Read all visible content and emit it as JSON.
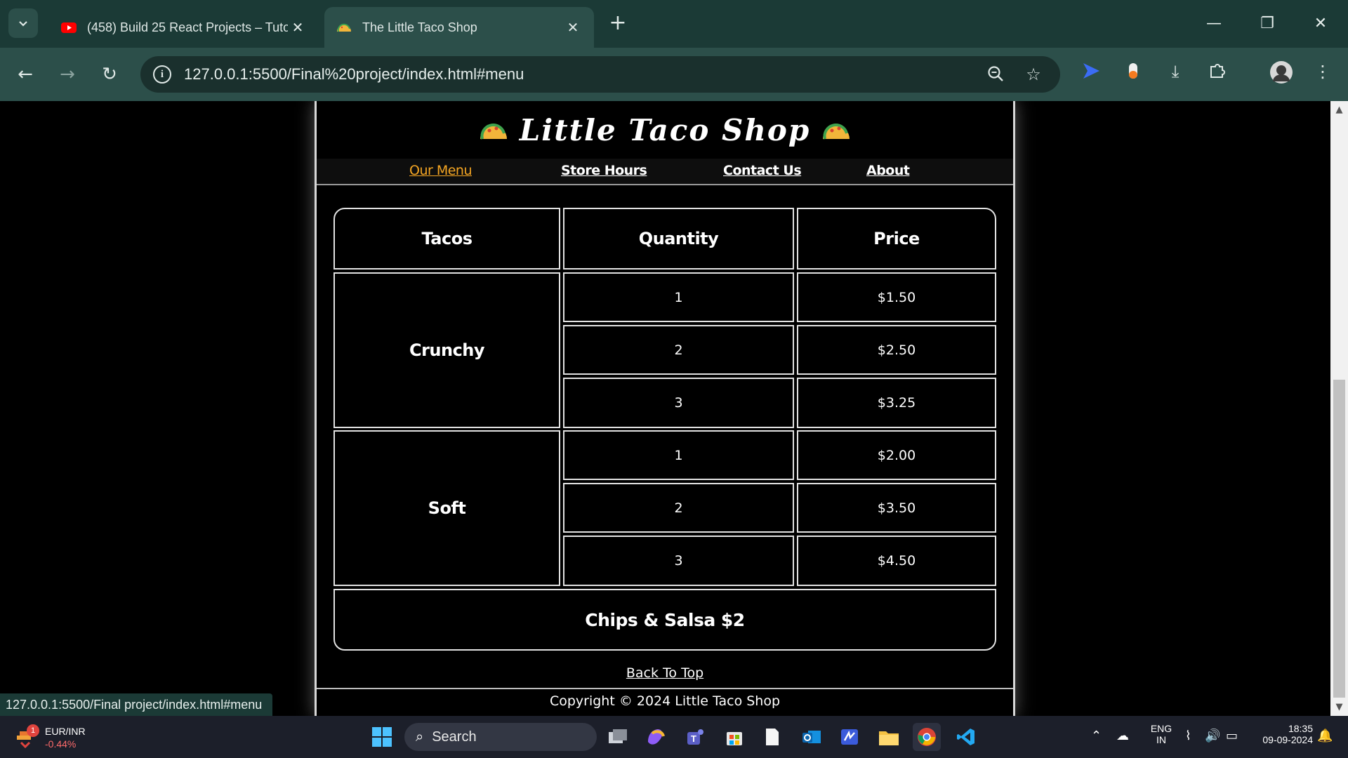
{
  "browser": {
    "tabs": [
      {
        "title": "(458) Build 25 React Projects – Tutorial",
        "favicon": "youtube-icon",
        "active": false
      },
      {
        "title": "The Little Taco Shop",
        "favicon": "taco-icon",
        "active": true
      }
    ],
    "url": "127.0.0.1:5500/Final%20project/index.html#menu",
    "status_url": "127.0.0.1:5500/Final project/index.html#menu"
  },
  "site": {
    "title": "Little Taco Shop",
    "nav": [
      {
        "label": "Our Menu",
        "current": true
      },
      {
        "label": "Store Hours",
        "current": false
      },
      {
        "label": "Contact Us",
        "current": false
      },
      {
        "label": "About",
        "current": false
      }
    ],
    "menu": {
      "headers": [
        "Tacos",
        "Quantity",
        "Price"
      ],
      "groups": [
        {
          "name": "Crunchy",
          "rows": [
            {
              "qty": "1",
              "price": "$1.50"
            },
            {
              "qty": "2",
              "price": "$2.50"
            },
            {
              "qty": "3",
              "price": "$3.25"
            }
          ]
        },
        {
          "name": "Soft",
          "rows": [
            {
              "qty": "1",
              "price": "$2.00"
            },
            {
              "qty": "2",
              "price": "$3.50"
            },
            {
              "qty": "3",
              "price": "$4.50"
            }
          ]
        }
      ],
      "footer": "Chips & Salsa $2"
    },
    "back_to_top": "Back To Top",
    "copyright": "Copyright © 2024 Little Taco Shop",
    "colors": {
      "current_link": "#f5a623",
      "background": "#000000",
      "border": "#e2e2e2"
    }
  },
  "taskbar": {
    "weather": {
      "label": "EUR/INR",
      "change": "-0.44%",
      "badge": "1"
    },
    "search_placeholder": "Search",
    "lang": {
      "top": "ENG",
      "bottom": "IN"
    },
    "time": "18:35",
    "date": "09-09-2024"
  }
}
